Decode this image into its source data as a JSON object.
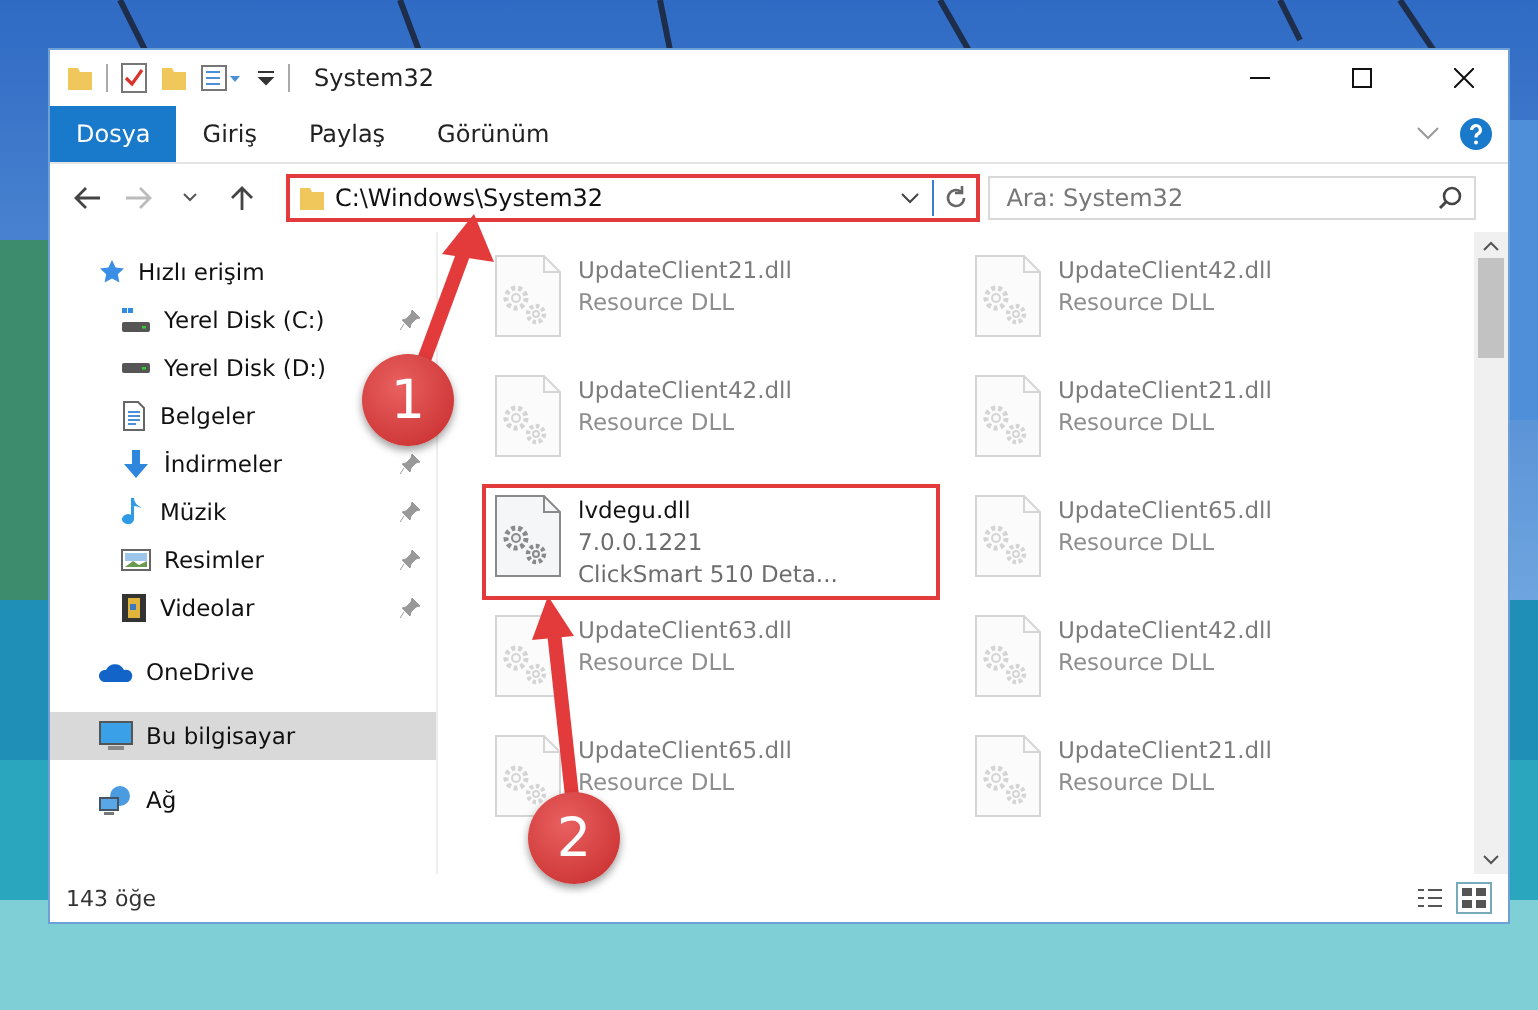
{
  "window": {
    "title": "System32"
  },
  "ribbon": {
    "file_tab": "Dosya",
    "tabs": [
      "Giriş",
      "Paylaş",
      "Görünüm"
    ]
  },
  "address": {
    "path": "C:\\Windows\\System32"
  },
  "search": {
    "placeholder": "Ara: System32"
  },
  "nav": [
    {
      "label": "Hızlı erişim",
      "kind": "star",
      "selected": false,
      "children": [
        {
          "label": "Yerel Disk (C:)",
          "kind": "drive-c",
          "pinned": true,
          "selected": false
        },
        {
          "label": "Yerel Disk (D:)",
          "kind": "drive",
          "selected": false
        },
        {
          "label": "Belgeler",
          "kind": "document",
          "selected": false
        },
        {
          "label": "İndirmeler",
          "kind": "download",
          "pinned": true,
          "selected": false
        },
        {
          "label": "Müzik",
          "kind": "music",
          "pinned": true,
          "selected": false
        },
        {
          "label": "Resimler",
          "kind": "pictures",
          "pinned": true,
          "selected": false
        },
        {
          "label": "Videolar",
          "kind": "video",
          "pinned": true,
          "selected": false
        }
      ]
    },
    {
      "label": "OneDrive",
      "kind": "cloud",
      "selected": false
    },
    {
      "label": "Bu bilgisayar",
      "kind": "computer",
      "selected": true
    },
    {
      "label": "Ağ",
      "kind": "network",
      "selected": false
    }
  ],
  "files": [
    {
      "name": "UpdateClient21.dll",
      "lines": [
        "Resource DLL"
      ],
      "blurred": true
    },
    {
      "name": "UpdateClient42.dll",
      "lines": [
        "Resource DLL"
      ],
      "blurred": true
    },
    {
      "name": "UpdateClient42.dll",
      "lines": [
        "Resource DLL"
      ],
      "blurred": true
    },
    {
      "name": "UpdateClient21.dll",
      "lines": [
        "Resource DLL"
      ],
      "blurred": true
    },
    {
      "name": "lvdegu.dll",
      "lines": [
        "7.0.0.1221",
        "ClickSmart 510 Deta..."
      ],
      "blurred": false
    },
    {
      "name": "UpdateClient65.dll",
      "lines": [
        "Resource DLL"
      ],
      "blurred": true
    },
    {
      "name": "UpdateClient63.dll",
      "lines": [
        "Resource DLL"
      ],
      "blurred": true
    },
    {
      "name": "UpdateClient42.dll",
      "lines": [
        "Resource DLL"
      ],
      "blurred": true
    },
    {
      "name": "UpdateClient65.dll",
      "lines": [
        "Resource DLL"
      ],
      "blurred": true
    },
    {
      "name": "UpdateClient21.dll",
      "lines": [
        "Resource DLL"
      ],
      "blurred": true
    }
  ],
  "status_bar": {
    "count": "143 öğe"
  },
  "callouts": [
    {
      "number": "1"
    },
    {
      "number": "2"
    }
  ]
}
